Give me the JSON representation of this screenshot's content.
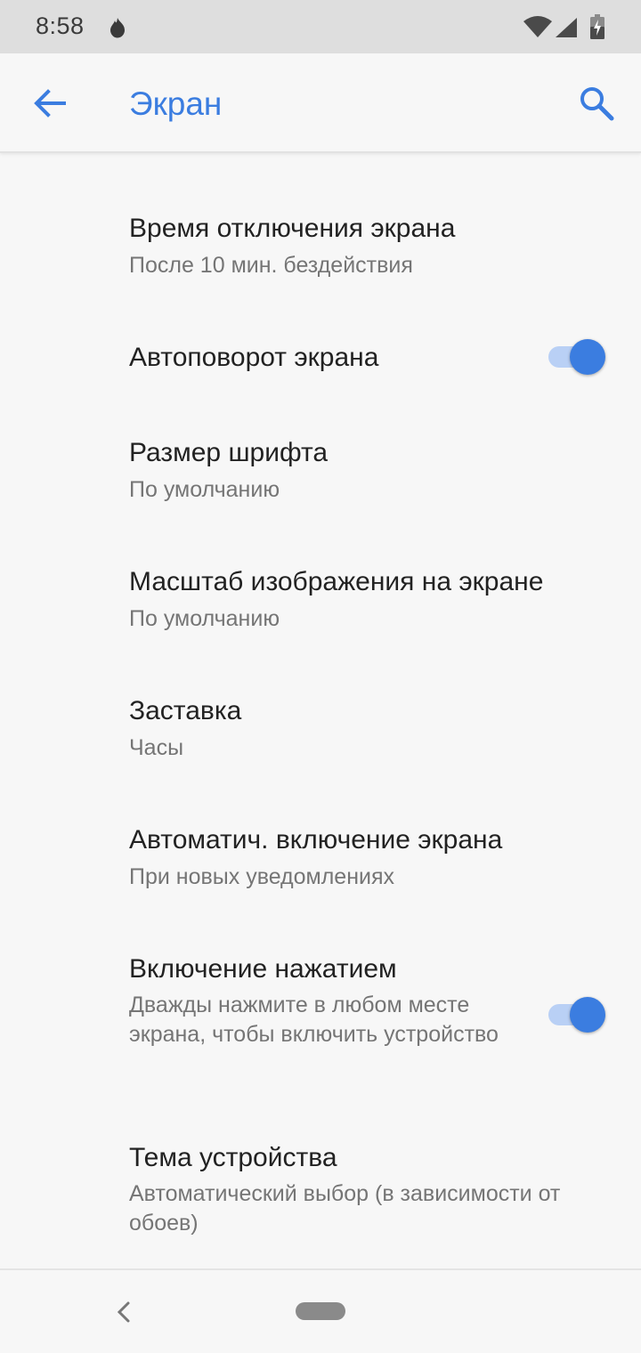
{
  "status_bar": {
    "time": "8:58",
    "icons": [
      "notification-flame-icon",
      "wifi-icon",
      "signal-icon",
      "battery-charging-icon"
    ]
  },
  "app_bar": {
    "title": "Экран",
    "back_icon": "arrow-back-icon",
    "search_icon": "search-icon"
  },
  "accent_color": "#3b7de0",
  "settings": [
    {
      "title": "Время отключения экрана",
      "subtitle": "После 10 мин. бездействия"
    },
    {
      "title": "Автоповорот экрана",
      "toggle": true
    },
    {
      "title": "Размер шрифта",
      "subtitle": "По умолчанию"
    },
    {
      "title": "Масштаб изображения на экране",
      "subtitle": "По умолчанию"
    },
    {
      "title": "Заставка",
      "subtitle": "Часы"
    },
    {
      "title": "Автоматич. включение экрана",
      "subtitle": "При новых уведомлениях"
    },
    {
      "title": "Включение нажатием",
      "subtitle": "Дважды нажмите в любом месте экрана, чтобы включить устройство",
      "toggle": true
    },
    {
      "title": "Тема устройства",
      "subtitle": "Автоматический выбор (в зависимости от обоев)"
    }
  ],
  "nav_bar": {
    "back_icon": "nav-back-icon",
    "home_icon": "nav-home-pill-icon"
  }
}
